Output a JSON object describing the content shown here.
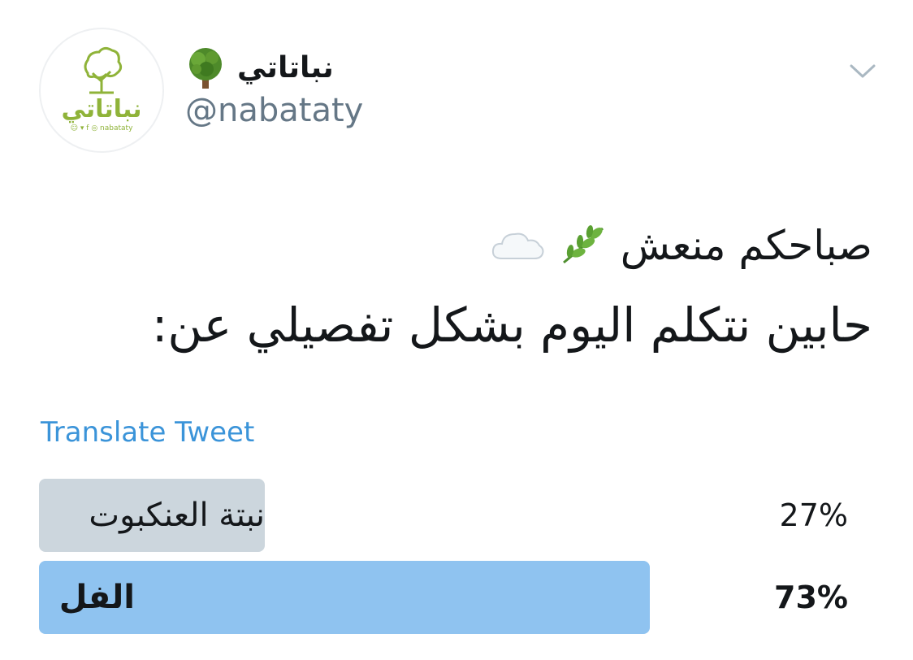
{
  "account": {
    "display_name": "نباتاتي",
    "handle": "@nabataty",
    "name_emoji": "deciduous-tree-emoji",
    "avatar": {
      "logo_text": "نباتاتي",
      "social_text": "nabataty",
      "brand_color": "#8fb339"
    }
  },
  "header": {
    "menu_icon": "chevron-down-icon"
  },
  "tweet": {
    "line1_text": "صباحكم منعش",
    "line1_emojis": [
      "herb-emoji",
      "cloud-emoji"
    ],
    "line2_text": "حابين نتكلم اليوم بشكل تفصيلي عن:"
  },
  "translate": {
    "label": "Translate Tweet",
    "color": "#3b94d9"
  },
  "poll": {
    "options": [
      {
        "label": "نبتة العنكبوت",
        "percent": "27%",
        "fraction": 0.27,
        "winner": false,
        "color": "#ccd6dd"
      },
      {
        "label": "الفل",
        "percent": "73%",
        "fraction": 0.73,
        "winner": true,
        "color": "#8fc3f0"
      }
    ]
  }
}
